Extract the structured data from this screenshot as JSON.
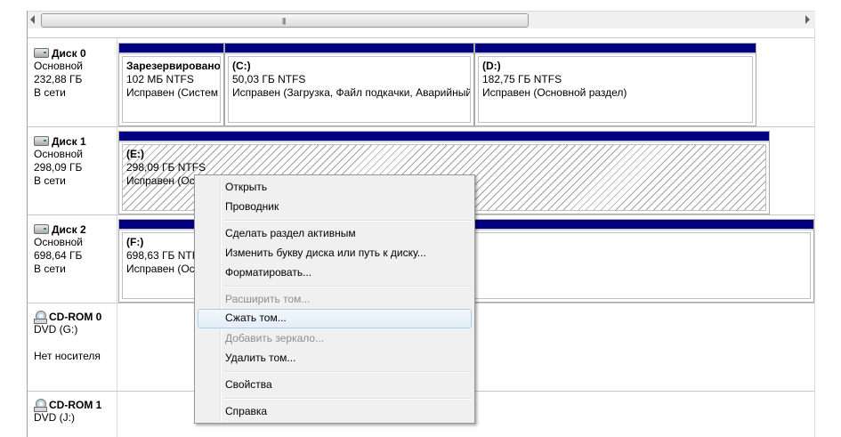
{
  "disks": [
    {
      "title": "Диск 0",
      "type": "Основной",
      "size": "232,88 ГБ",
      "status": "В сети"
    },
    {
      "title": "Диск 1",
      "type": "Основной",
      "size": "298,09 ГБ",
      "status": "В сети"
    },
    {
      "title": "Диск 2",
      "type": "Основной",
      "size": "698,64 ГБ",
      "status": "В сети"
    }
  ],
  "cdroms": [
    {
      "title": "CD-ROM 0",
      "drive": "DVD (G:)",
      "media": "Нет носителя"
    },
    {
      "title": "CD-ROM 1",
      "drive": "DVD (J:)"
    }
  ],
  "partitions": {
    "d0_reserved": {
      "name": "Зарезервировано",
      "size": "102 МБ NTFS",
      "status": "Исправен (Систем"
    },
    "d0_c": {
      "name": "(C:)",
      "size": "50,03 ГБ NTFS",
      "status": "Исправен (Загрузка, Файл подкачки, Аварийный"
    },
    "d0_d": {
      "name": "(D:)",
      "size": "182,75 ГБ NTFS",
      "status": "Исправен (Основной раздел)"
    },
    "d1_e": {
      "name": "(E:)",
      "size": "298,09 ГБ NTFS",
      "status": "Исправен (Ос"
    },
    "d2_f": {
      "name": "(F:)",
      "size": "698,63 ГБ NTFS",
      "status": "Исправен (Ос"
    }
  },
  "context_menu": {
    "open": "Открыть",
    "explorer": "Проводник",
    "mark_active": "Сделать раздел активным",
    "change_letter": "Изменить букву диска или путь к диску...",
    "format": "Форматировать...",
    "extend": "Расширить том...",
    "shrink": "Сжать том...",
    "add_mirror": "Добавить зеркало...",
    "delete": "Удалить том...",
    "properties": "Свойства",
    "help": "Справка"
  },
  "colors": {
    "partition_bar": "#000080",
    "menu_bg": "#f0f0f0",
    "hover_border": "#a8d0f0"
  }
}
